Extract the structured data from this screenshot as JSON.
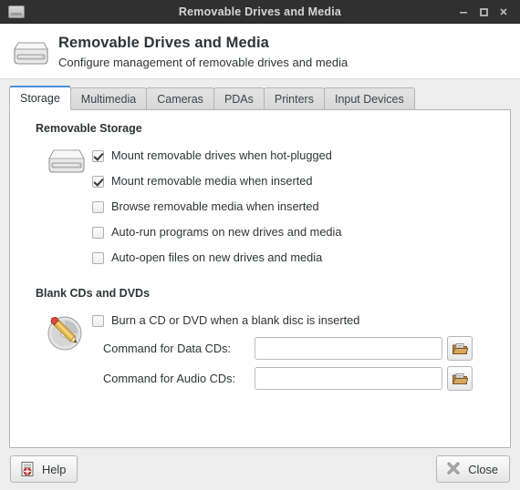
{
  "window": {
    "title": "Removable Drives and Media",
    "icon": "drive-icon",
    "controls": [
      {
        "name": "minimize-button",
        "glyph": "minimize-icon"
      },
      {
        "name": "maximize-button",
        "glyph": "maximize-icon"
      },
      {
        "name": "close-button",
        "glyph": "close-icon"
      }
    ]
  },
  "header": {
    "icon": "removable-drive-icon",
    "title": "Removable Drives and Media",
    "subtitle": "Configure management of removable drives and media"
  },
  "tabs": [
    {
      "label": "Storage",
      "active": true
    },
    {
      "label": "Multimedia",
      "active": false
    },
    {
      "label": "Cameras",
      "active": false
    },
    {
      "label": "PDAs",
      "active": false
    },
    {
      "label": "Printers",
      "active": false
    },
    {
      "label": "Input Devices",
      "active": false
    }
  ],
  "storage": {
    "section_title": "Removable Storage",
    "icon": "hard-drive-icon",
    "options": [
      {
        "label": "Mount removable drives when hot-plugged",
        "checked": true
      },
      {
        "label": "Mount removable media when inserted",
        "checked": true
      },
      {
        "label": "Browse removable media when inserted",
        "checked": false
      },
      {
        "label": "Auto-run programs on new drives and media",
        "checked": false
      },
      {
        "label": "Auto-open files on new drives and media",
        "checked": false
      }
    ]
  },
  "blank_discs": {
    "section_title": "Blank CDs and DVDs",
    "icon": "cd-write-icon",
    "options": [
      {
        "label": "Burn a CD or DVD when a blank disc is inserted",
        "checked": false
      }
    ],
    "fields": [
      {
        "label": "Command for Data CDs:",
        "value": "",
        "placeholder": "",
        "browse_icon": "folder-open-icon"
      },
      {
        "label": "Command for Audio CDs:",
        "value": "",
        "placeholder": "",
        "browse_icon": "folder-open-icon"
      }
    ]
  },
  "footer": {
    "help_label": "Help",
    "help_icon": "help-document-icon",
    "close_label": "Close",
    "close_icon": "close-x-icon"
  },
  "colors": {
    "titlebar_bg": "#303030",
    "titlebar_text": "#d6d6d6",
    "window_bg": "#ededed",
    "panel_bg": "#ffffff",
    "text": "#2e3436",
    "tab_accent": "#4a90d9"
  }
}
